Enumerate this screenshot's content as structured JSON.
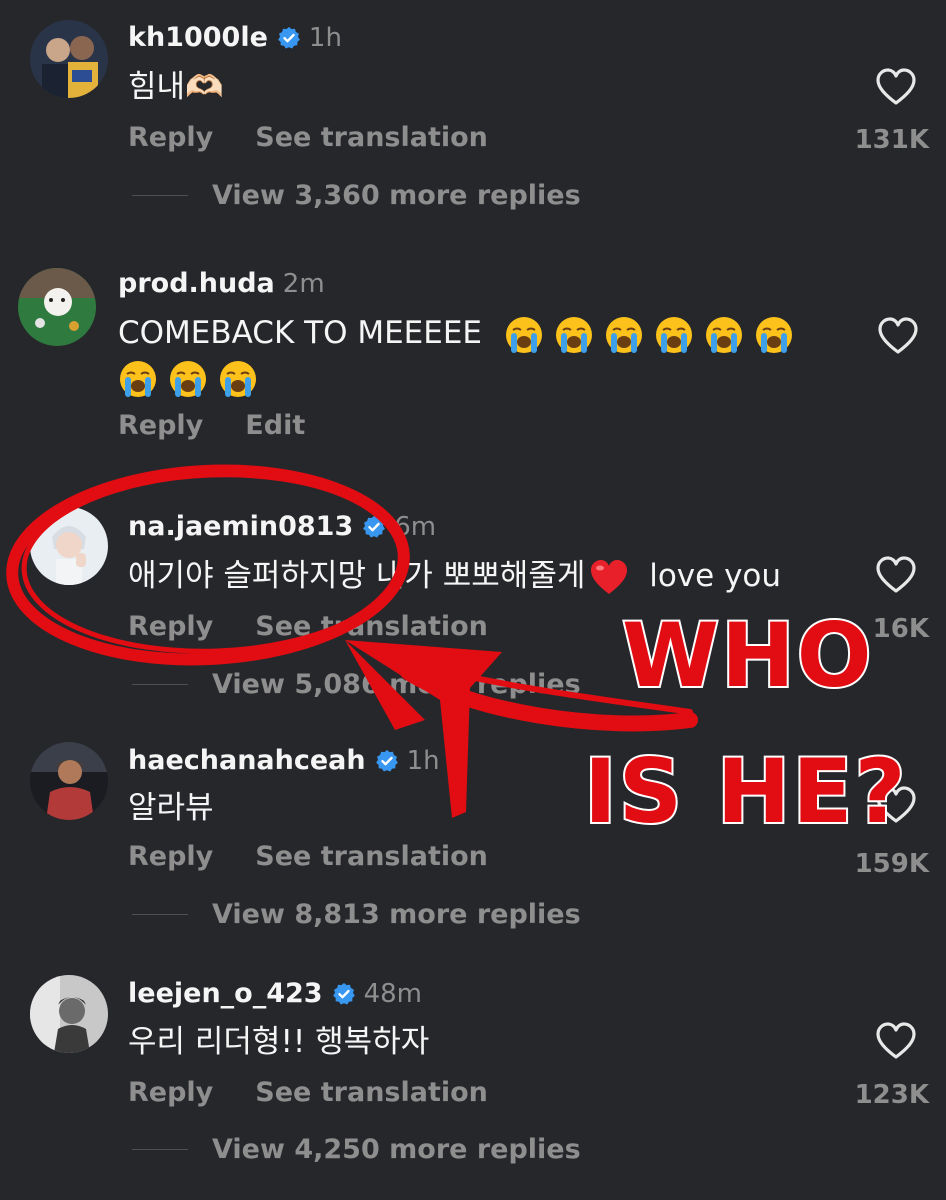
{
  "comments": [
    {
      "username": "kh1000le",
      "verified": true,
      "time": "1h",
      "text": "힘내🫶🏻",
      "actions": [
        "Reply",
        "See translation"
      ],
      "likes": "131K",
      "replies": "View 3,360 more replies"
    },
    {
      "username": "prod.huda",
      "verified": false,
      "time": "2m",
      "text": "COMEBACK TO MEEEEE",
      "emoji_count": 9,
      "emoji_name": "loudly-crying-face",
      "actions": [
        "Reply",
        "Edit"
      ]
    },
    {
      "username": "na.jaemin0813",
      "verified": true,
      "time": "6m",
      "text": "애기야 슬퍼하지망 내가 뽀뽀해줄게",
      "text_after": " love you",
      "emoji_name": "red-heart",
      "actions": [
        "Reply",
        "See translation"
      ],
      "likes": "16K",
      "replies": "View 5,086 more replies"
    },
    {
      "username": "haechanahceah",
      "verified": true,
      "time": "1h",
      "text": "알라뷰",
      "actions": [
        "Reply",
        "See translation"
      ],
      "likes": "159K",
      "replies": "View 8,813 more replies"
    },
    {
      "username": "leejen_o_423",
      "verified": true,
      "time": "48m",
      "text": "우리 리더형!! 행복하자",
      "actions": [
        "Reply",
        "See translation"
      ],
      "likes": "123K",
      "replies": "View 4,250 more replies"
    }
  ],
  "overlay": {
    "line1": "WHO",
    "line2": "IS HE?",
    "accent_color": "#e10d12"
  },
  "icons": {
    "verified": "verified-badge-icon",
    "like": "heart-outline-icon"
  }
}
